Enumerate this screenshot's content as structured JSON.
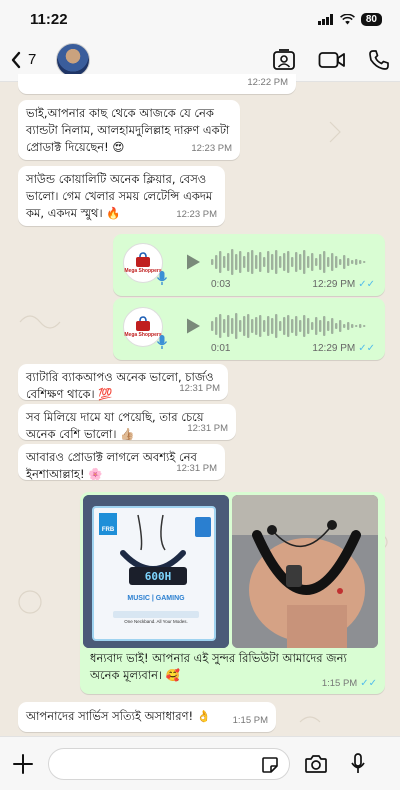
{
  "status_bar": {
    "time": "11:22",
    "battery": "80"
  },
  "header": {
    "back_count": "7"
  },
  "messages": [
    {
      "id": "m0",
      "time": "12:22 PM"
    },
    {
      "id": "m1",
      "text": "ভাই,আপনার কাছ থেকে আজকে যে নেক ব্যান্ডটা নিলাম, আলহামদুলিল্লাহ দারুণ একটা প্রোডাক্ট দিয়েছেন! 😍",
      "time": "12:23 PM"
    },
    {
      "id": "m2",
      "text": "সাউন্ড কোয়ালিটি অনেক ক্লিয়ার, বেসও ভালো। গেম খেলার সময় লেটেন্সি একদম কম, একদম স্মুথ। 🔥",
      "time": "12:23 PM"
    },
    {
      "id": "m5",
      "text": "ব্যাটারি ব্যাকআপও অনেক ভালো, চার্জও বেশিক্ষণ থাকে। 💯",
      "time": "12:31 PM"
    },
    {
      "id": "m6",
      "text": "সব মিলিয়ে দামে যা পেয়েছি, তার চেয়ে অনেক বেশি ভালো। 👍🏼",
      "time": "12:31 PM"
    },
    {
      "id": "m7",
      "text": "আবারও প্রোডাক্ট লাগলে অবশ্যই নেব ইনশাআল্লাহ! 🌸",
      "time": "12:31 PM"
    },
    {
      "id": "m9",
      "text": "আপনাদের সার্ভিস সত্যিই অসাধারণ! 👌",
      "time": "1:15 PM"
    }
  ],
  "voice_notes": [
    {
      "duration": "0:03",
      "time": "12:29 PM",
      "logo_text": "Mega Shoppers"
    },
    {
      "duration": "0:01",
      "time": "12:29 PM",
      "logo_text": "Mega Shoppers"
    }
  ],
  "photo_message": {
    "caption": "ধন্যবাদ ভাই! আপনার এই সুন্দর রিভিউটা আমাদের জন্য অনেক মূল্যবান। 🥰",
    "time": "1:15 PM",
    "box_brand": "FRB",
    "box_display": "600H",
    "box_tagline": "MUSIC | GAMING",
    "box_subtitle": "One Neckband. All Your Modes."
  },
  "colors": {
    "incoming": "#ffffff",
    "outgoing": "#d9fdd3",
    "read_ticks": "#53bdeb",
    "background": "#efe9e0"
  }
}
